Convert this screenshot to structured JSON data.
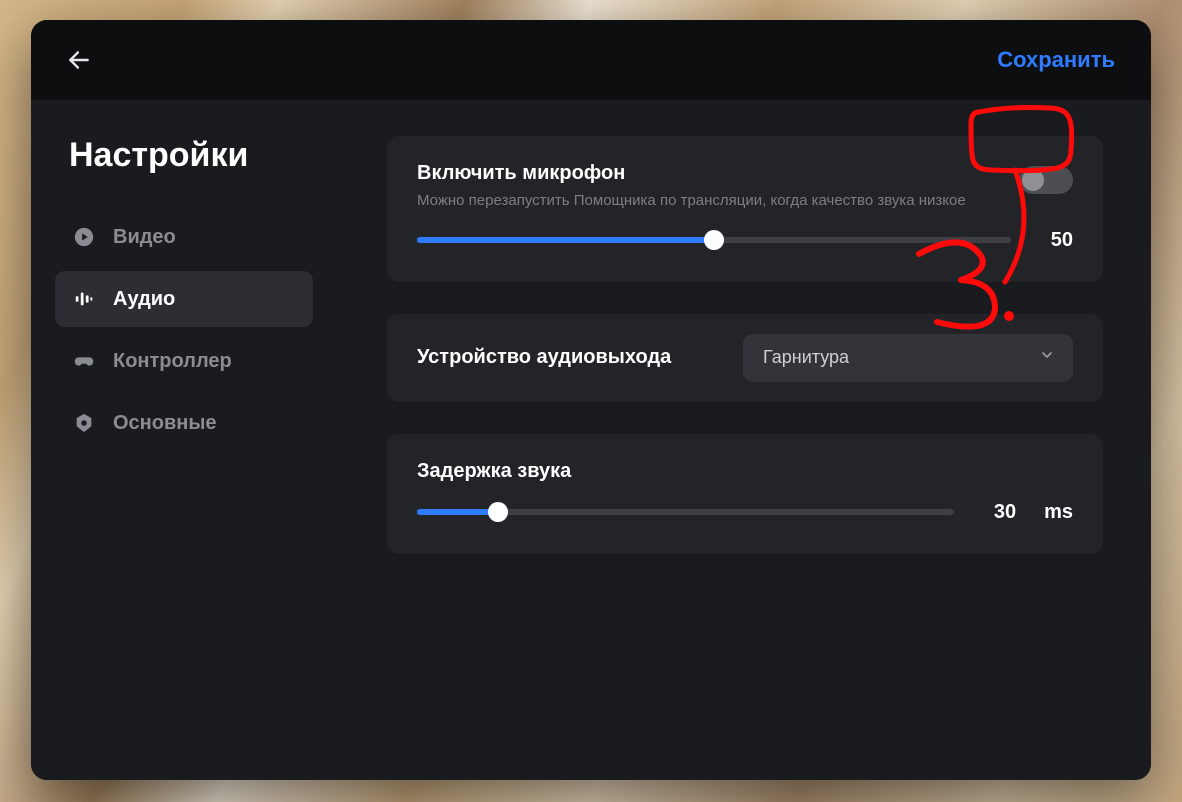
{
  "header": {
    "save_label": "Сохранить"
  },
  "page": {
    "title": "Настройки"
  },
  "sidebar": {
    "items": [
      {
        "id": "video",
        "label": "Видео",
        "icon": "play-circle-icon",
        "active": false
      },
      {
        "id": "audio",
        "label": "Аудио",
        "icon": "equalizer-icon",
        "active": true
      },
      {
        "id": "controller",
        "label": "Контроллер",
        "icon": "controller-icon",
        "active": false
      },
      {
        "id": "general",
        "label": "Основные",
        "icon": "hex-gear-icon",
        "active": false
      }
    ]
  },
  "audio": {
    "mic": {
      "title": "Включить микрофон",
      "subtitle": "Можно перезапустить Помощника по трансляции, когда качество звука низкое",
      "enabled": false,
      "volume": 50
    },
    "output": {
      "label": "Устройство аудиовыхода",
      "selected": "Гарнитура"
    },
    "delay": {
      "title": "Задержка звука",
      "value": 30,
      "unit": "ms",
      "max": 200
    }
  },
  "annotation": {
    "label": "3."
  },
  "colors": {
    "accent": "#2f7bff",
    "annotation": "#ff0a0a",
    "card_bg": "#232428",
    "modal_bg": "#1a1b1e",
    "header_bg": "#0d0e10"
  }
}
